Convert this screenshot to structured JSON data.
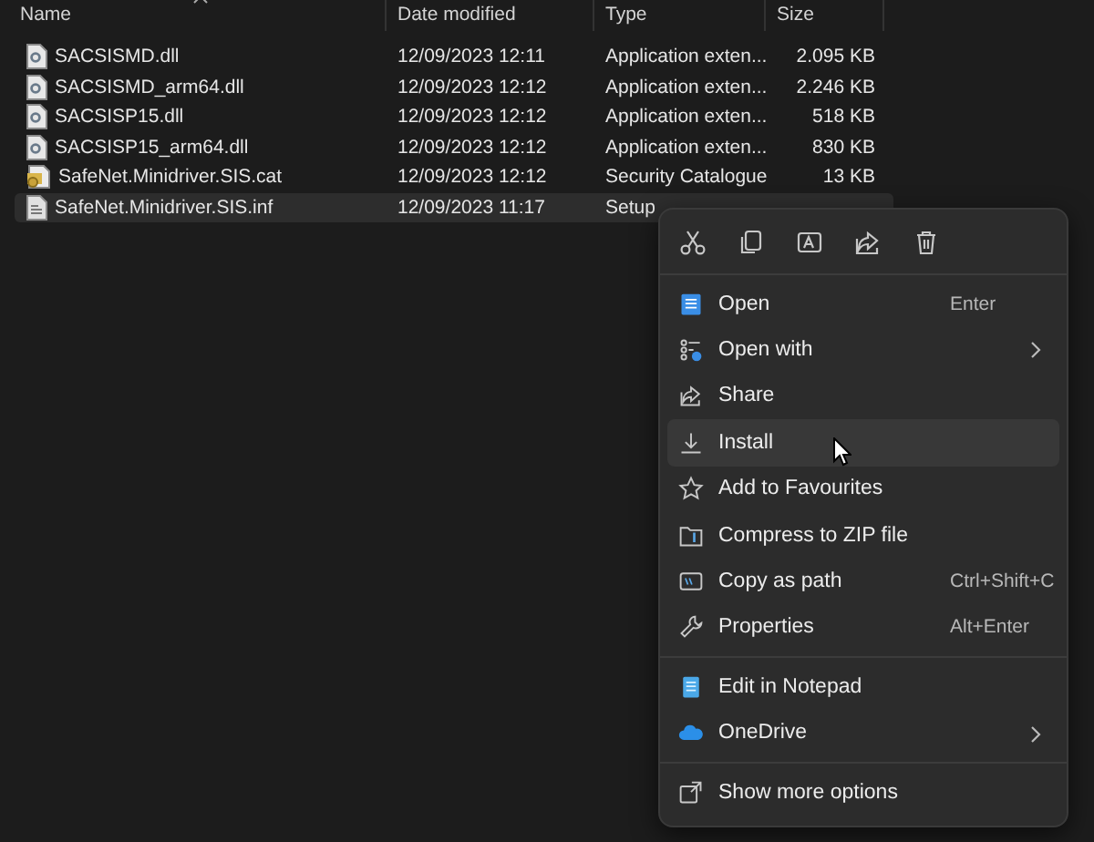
{
  "file_list": {
    "columns": [
      "Name",
      "Date modified",
      "Type",
      "Size"
    ],
    "rows": [
      {
        "kind": "extension",
        "name": "SACSISMD.dll",
        "date": "12/09/2023 12:11",
        "type": "Application exten...",
        "size": "2.095 KB",
        "selected": false
      },
      {
        "kind": "extension",
        "name": "SACSISMD_arm64.dll",
        "date": "12/09/2023 12:12",
        "type": "Application exten...",
        "size": "2.246 KB",
        "selected": false
      },
      {
        "kind": "extension",
        "name": "SACSISP15.dll",
        "date": "12/09/2023 12:12",
        "type": "Application exten...",
        "size": "518 KB",
        "selected": false
      },
      {
        "kind": "extension",
        "name": "SACSISP15_arm64.dll",
        "date": "12/09/2023 12:12",
        "type": "Application exten...",
        "size": "830 KB",
        "selected": false
      },
      {
        "kind": "catalog",
        "name": "SafeNet.Minidriver.SIS.cat",
        "date": "12/09/2023 12:12",
        "type": "Security Catalogue",
        "size": "13 KB",
        "selected": false
      },
      {
        "kind": "setup",
        "name": "SafeNet.Minidriver.SIS.inf",
        "date": "12/09/2023 11:17",
        "type": "Setup",
        "selected": true
      }
    ]
  },
  "context_menu": {
    "sections": [
      [
        {
          "label": "Open",
          "shortcut": "Enter",
          "submenu": false,
          "selected": false
        },
        {
          "label": "Open with",
          "submenu": true,
          "selected": false
        },
        {
          "label": "Share",
          "submenu": false,
          "selected": false
        },
        {
          "label": "Install",
          "submenu": false,
          "selected": true
        },
        {
          "label": "Add to Favourites",
          "submenu": false,
          "selected": false
        },
        {
          "label": "Compress to ZIP file",
          "submenu": false,
          "selected": false
        },
        {
          "label": "Copy as path",
          "shortcut": "Ctrl+Shift+C",
          "submenu": false,
          "selected": false
        },
        {
          "label": "Properties",
          "shortcut": "Alt+Enter",
          "submenu": false,
          "selected": false
        }
      ],
      [
        {
          "label": "Edit in Notepad",
          "submenu": false,
          "selected": false
        },
        {
          "label": "OneDrive",
          "submenu": true,
          "selected": false
        }
      ],
      [
        {
          "label": "Show more options",
          "submenu": false,
          "selected": false
        }
      ]
    ]
  }
}
